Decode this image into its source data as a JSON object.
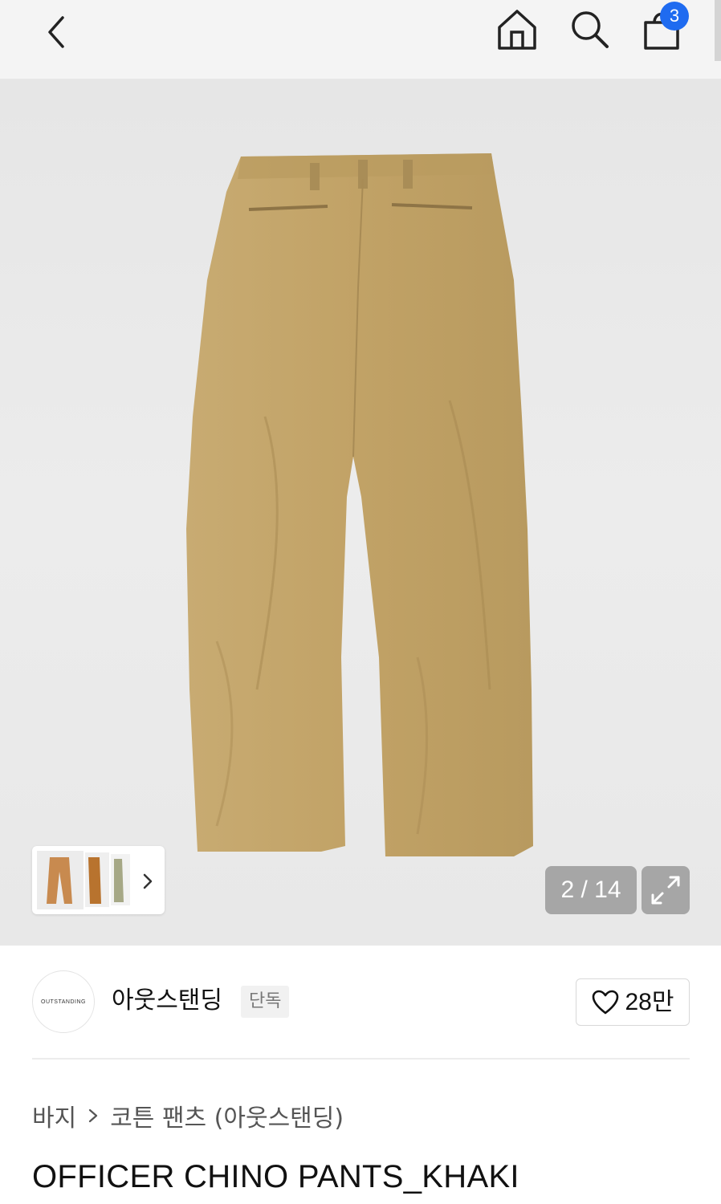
{
  "header": {
    "back_icon": "chevron-left-icon",
    "home_icon": "home-icon",
    "search_icon": "search-icon",
    "bag_icon": "shopping-bag-icon",
    "cart_count": "3",
    "badge_color": "#1f6bf0"
  },
  "gallery": {
    "counter": "2 / 14",
    "thumb_arrow_icon": "chevron-right-icon",
    "expand_icon": "expand-icon",
    "product_color": "#c4a56b"
  },
  "brand": {
    "logo_text": "OUTSTANDING",
    "name": "아웃스탠딩",
    "badge": "단독",
    "like_icon": "heart-outline-icon",
    "like_count": "28만"
  },
  "breadcrumb": {
    "category": "바지",
    "subcategory": "코튼 팬츠 (아웃스탠딩)"
  },
  "product": {
    "title": "OFFICER CHINO PANTS_KHAKI"
  }
}
